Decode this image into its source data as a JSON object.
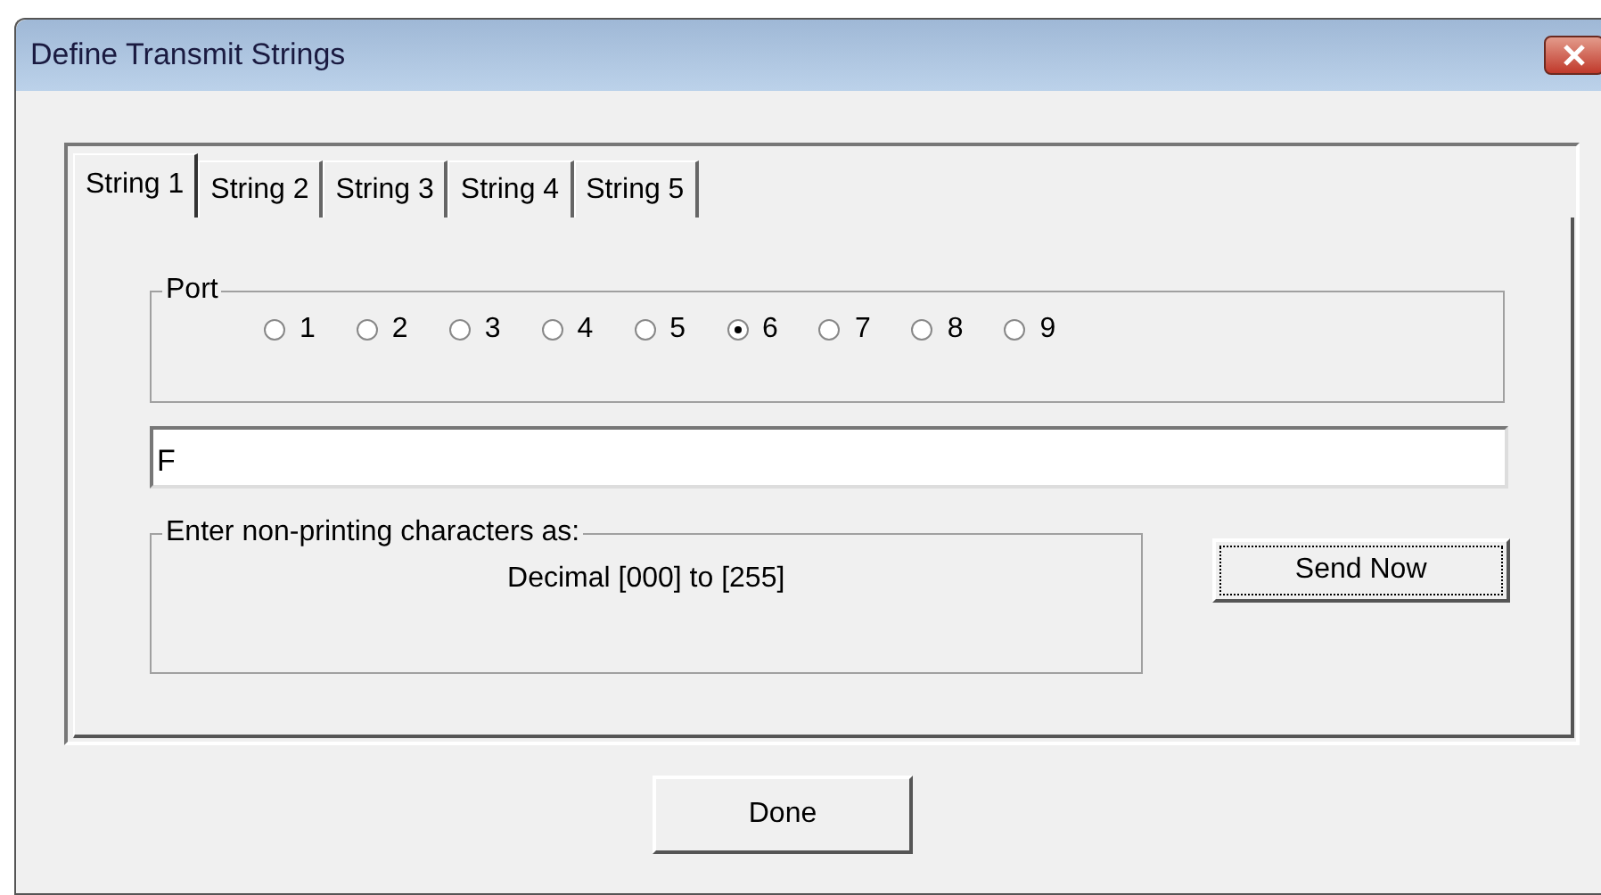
{
  "window": {
    "title": "Define Transmit Strings"
  },
  "tabs": [
    {
      "label": "String 1",
      "selected": true
    },
    {
      "label": "String 2",
      "selected": false
    },
    {
      "label": "String 3",
      "selected": false
    },
    {
      "label": "String 4",
      "selected": false
    },
    {
      "label": "String 5",
      "selected": false
    }
  ],
  "port": {
    "label": "Port",
    "options": [
      {
        "label": "1",
        "selected": false
      },
      {
        "label": "2",
        "selected": false
      },
      {
        "label": "3",
        "selected": false
      },
      {
        "label": "4",
        "selected": false
      },
      {
        "label": "5",
        "selected": false
      },
      {
        "label": "6",
        "selected": true
      },
      {
        "label": "7",
        "selected": false
      },
      {
        "label": "8",
        "selected": false
      },
      {
        "label": "9",
        "selected": false
      }
    ]
  },
  "string_field": {
    "value": "F"
  },
  "hint": {
    "label": "Enter non-printing characters as:",
    "text": "Decimal [000] to [255]"
  },
  "buttons": {
    "send": "Send Now",
    "done": "Done"
  }
}
